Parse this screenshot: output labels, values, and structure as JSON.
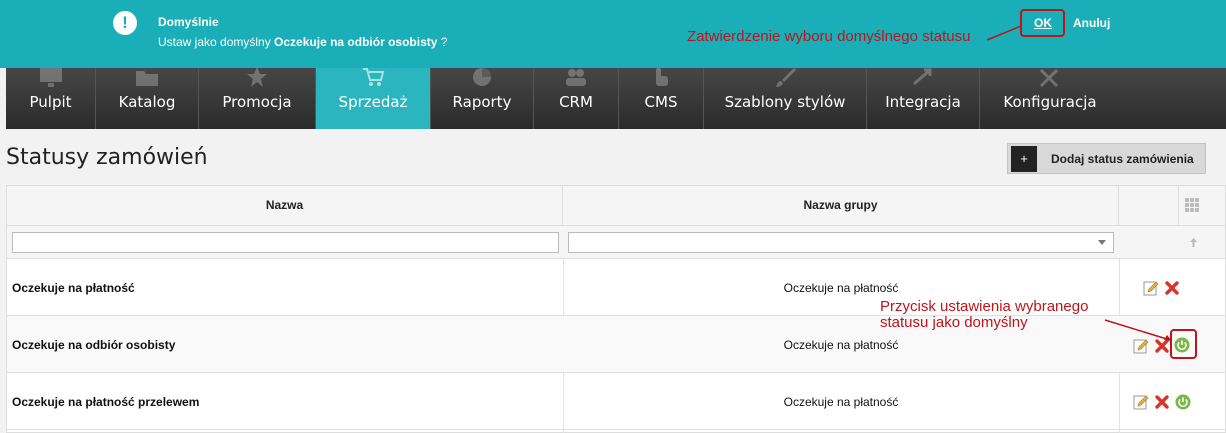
{
  "confirm_bar": {
    "icon": "exclamation-icon",
    "title": "Domyślnie",
    "message_prefix": "Ustaw jako domyślny ",
    "message_bold": "Oczekuje na odbiór osobisty",
    "message_suffix": " ?",
    "ok_label": "OK",
    "cancel_label": "Anuluj"
  },
  "annotations": {
    "ok_note": "Zatwierdzenie wyboru domyślnego statusu",
    "default_note_line1": "Przycisk ustawienia wybranego",
    "default_note_line2": "statusu jako domyślny"
  },
  "nav": {
    "items": [
      {
        "label": "Pulpit",
        "icon": "monitor-icon"
      },
      {
        "label": "Katalog",
        "icon": "folder-icon"
      },
      {
        "label": "Promocja",
        "icon": "star-icon"
      },
      {
        "label": "Sprzedaż",
        "icon": "cart-icon",
        "active": true
      },
      {
        "label": "Raporty",
        "icon": "pie-chart-icon"
      },
      {
        "label": "CRM",
        "icon": "users-icon"
      },
      {
        "label": "CMS",
        "icon": "hand-icon"
      },
      {
        "label": "Szablony stylów",
        "icon": "brush-icon"
      },
      {
        "label": "Integracja",
        "icon": "arrows-icon"
      },
      {
        "label": "Konfiguracja",
        "icon": "tools-icon"
      }
    ]
  },
  "page": {
    "title": "Statusy zamówień",
    "add_button_icon": "+",
    "add_button_label": "Dodaj status zamówienia"
  },
  "table": {
    "columns": [
      "Nazwa",
      "Nazwa grupy"
    ],
    "rows": [
      {
        "name": "Oczekuje na płatność",
        "group": "Oczekuje na płatność",
        "is_default": true
      },
      {
        "name": "Oczekuje na odbiór osobisty",
        "group": "Oczekuje na płatność",
        "is_default": false
      },
      {
        "name": "Oczekuje na płatność przelewem",
        "group": "Oczekuje na płatność",
        "is_default": false
      }
    ]
  },
  "colors": {
    "accent": "#19aeb8",
    "nav_active": "#2bb6bf",
    "annotation": "#c0141a",
    "delete": "#d9322b",
    "default_green": "#7ab648"
  }
}
